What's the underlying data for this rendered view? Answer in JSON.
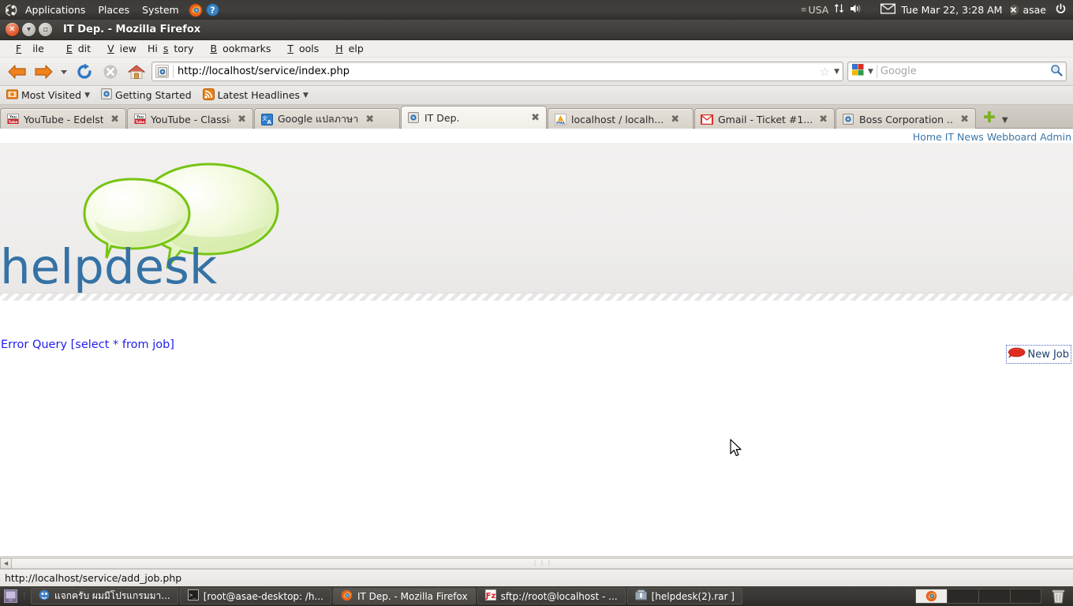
{
  "desktop": {
    "panel": {
      "menus": [
        "Applications",
        "Places",
        "System"
      ],
      "launchers": [
        "firefox-launcher-icon",
        "help-launcher-icon"
      ],
      "keyboard_indicator": "USA",
      "network_icon": "network-updown-icon",
      "volume_icon": "volume-icon",
      "mail_icon": "mail-envelope-icon",
      "clock": "Tue Mar 22,  3:28 AM",
      "user": "asae",
      "power_icon": "power-icon"
    },
    "taskbar": {
      "items": [
        {
          "icon": "pidgin-icon",
          "label": "แจกครับ ผมมีโปรแกรมมา...",
          "active": false
        },
        {
          "icon": "terminal-icon",
          "label": "[root@asae-desktop: /h...",
          "active": false
        },
        {
          "icon": "firefox-icon",
          "label": "IT Dep. - Mozilla Firefox",
          "active": true
        },
        {
          "icon": "filezilla-icon",
          "label": "sftp://root@localhost - ...",
          "active": false
        },
        {
          "icon": "archive-icon",
          "label": "[helpdesk(2).rar ]",
          "active": false
        }
      ],
      "workspaces": 4,
      "active_workspace": 1,
      "trash_icon": "trash-icon",
      "show_desktop_icon": "show-desktop-icon"
    }
  },
  "browser": {
    "window_title": "IT Dep. - Mozilla Firefox",
    "window_buttons": [
      "close-button",
      "minimize-button",
      "maximize-button"
    ],
    "menubar": [
      "File",
      "Edit",
      "View",
      "History",
      "Bookmarks",
      "Tools",
      "Help"
    ],
    "nav": {
      "back_icon": "back-arrow-icon",
      "forward_icon": "forward-arrow-icon",
      "history_dropdown_icon": "chevron-down-icon",
      "reload_icon": "reload-icon",
      "stop_icon": "stop-icon",
      "home_icon": "home-icon"
    },
    "urlbar": {
      "value": "http://localhost/service/index.php",
      "favicon": "page-favicon",
      "bookmark_star_icon": "star-icon",
      "dropdown_icon": "chevron-down-icon"
    },
    "search": {
      "engine_icon": "google-icon",
      "engine_dropdown_icon": "chevron-down-icon",
      "placeholder": "Google",
      "go_icon": "search-icon"
    },
    "bookmarks_toolbar": [
      {
        "icon": "most-visited-icon",
        "label": "Most Visited",
        "has_menu": true
      },
      {
        "icon": "getting-started-icon",
        "label": "Getting Started",
        "has_menu": false
      },
      {
        "icon": "rss-icon",
        "label": "Latest Headlines",
        "has_menu": true
      }
    ],
    "tabs": [
      {
        "favicon": "youtube-icon",
        "label": "YouTube - Edelst...",
        "active": false
      },
      {
        "favicon": "youtube-icon",
        "label": "YouTube - Classic...",
        "active": false
      },
      {
        "favicon": "google-translate-icon",
        "label": "Google แปลภาษา",
        "active": false
      },
      {
        "favicon": "page-favicon",
        "label": "IT Dep.",
        "active": true
      },
      {
        "favicon": "phpmyadmin-icon",
        "label": "localhost / localh...",
        "active": false
      },
      {
        "favicon": "gmail-icon",
        "label": "Gmail - Ticket #1...",
        "active": false
      },
      {
        "favicon": "page-favicon",
        "label": "Boss Corporation ...",
        "active": false
      }
    ],
    "tab_close_glyph": "✖",
    "new_tab_icon": "new-tab-plus-icon",
    "tab_list_icon": "chevron-down-icon",
    "statusbar": {
      "link_url": "http://localhost/service/add_job.php"
    },
    "scrollbar": {
      "left_arrow_icon": "scroll-left-icon",
      "grip_icon": "scrollbar-grip"
    }
  },
  "page": {
    "nav_links": [
      "Home",
      "IT News",
      "Webboard",
      "Admin"
    ],
    "nav_links_text": "Home IT News Webboard Admin",
    "logo": {
      "wordmark": "helpdesk",
      "icon": "speech-bubbles-icon"
    },
    "error_text": "Error Query [select * from job]",
    "new_job_button": {
      "icon": "red-speech-bubble-icon",
      "label": "New Job"
    },
    "colors": {
      "link_blue": "#3a76a8",
      "error_blue": "#1d1df0",
      "logo_blue": "#3572a5",
      "logo_green": "#76c412",
      "page_bg": "#ffffff",
      "hero_bg": "#f0efee"
    }
  }
}
